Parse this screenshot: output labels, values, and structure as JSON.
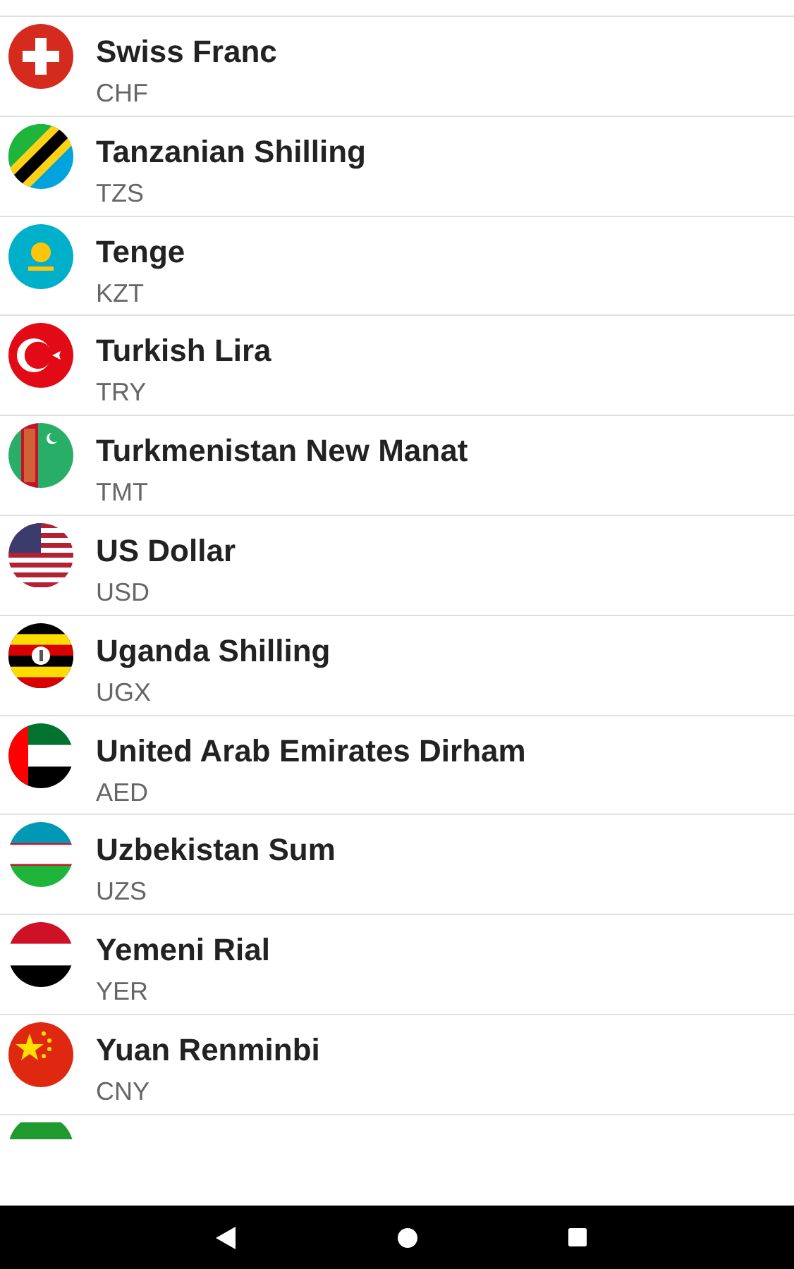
{
  "currencies": [
    {
      "name": "Swiss Franc",
      "code": "CHF"
    },
    {
      "name": "Tanzanian Shilling",
      "code": "TZS"
    },
    {
      "name": "Tenge",
      "code": "KZT"
    },
    {
      "name": "Turkish Lira",
      "code": "TRY"
    },
    {
      "name": "Turkmenistan New Manat",
      "code": "TMT"
    },
    {
      "name": "US Dollar",
      "code": "USD"
    },
    {
      "name": "Uganda Shilling",
      "code": "UGX"
    },
    {
      "name": "United Arab Emirates Dirham",
      "code": "AED"
    },
    {
      "name": "Uzbekistan Sum",
      "code": "UZS"
    },
    {
      "name": "Yemeni Rial",
      "code": "YER"
    },
    {
      "name": "Yuan Renminbi",
      "code": "CNY"
    }
  ]
}
